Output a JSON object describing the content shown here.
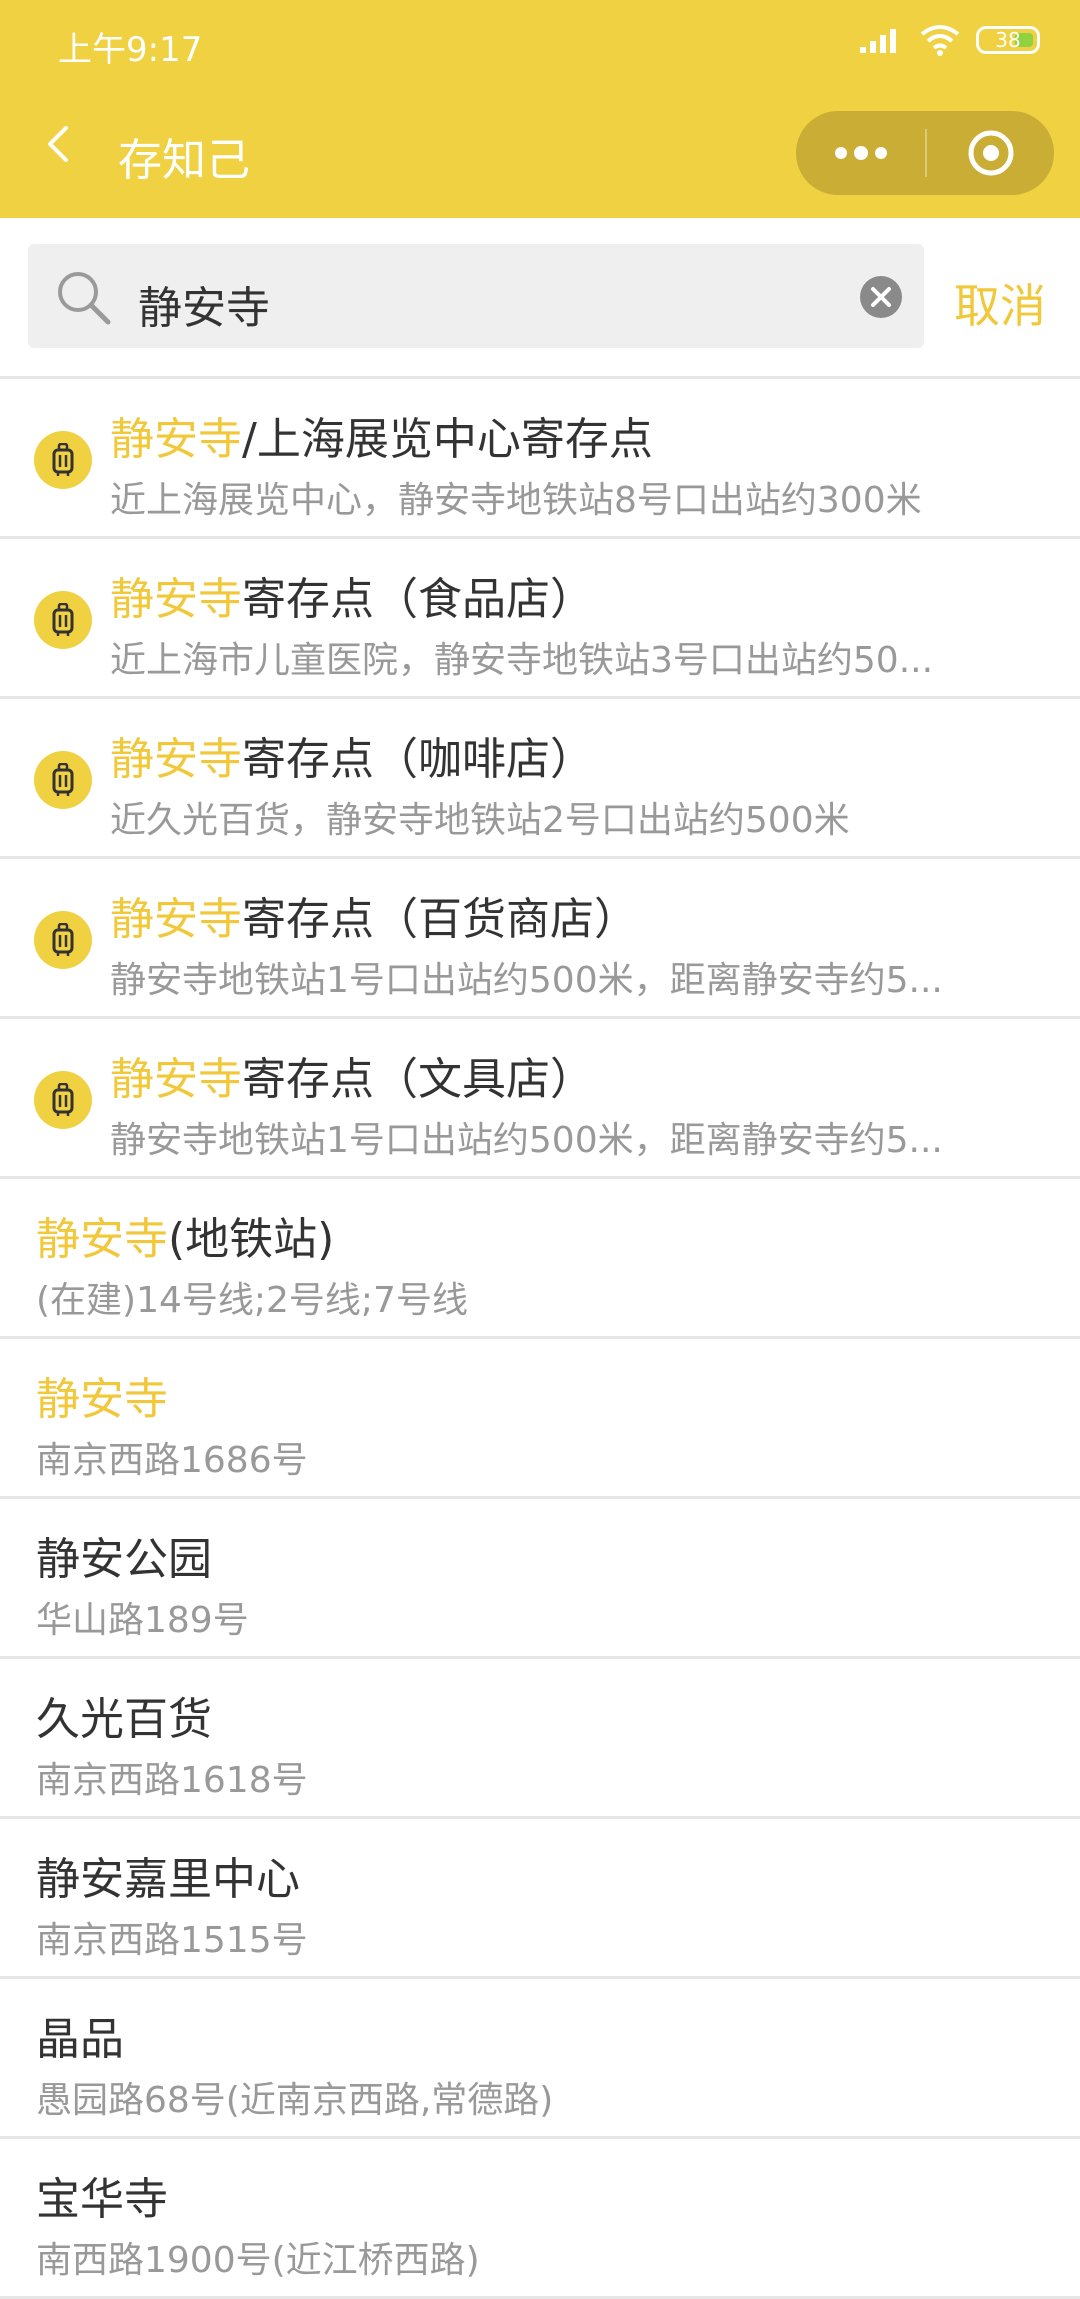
{
  "status_bar": {
    "time": "上午9:17",
    "battery": "38"
  },
  "nav": {
    "title": "存知己"
  },
  "search": {
    "query": "静安寺",
    "cancel_label": "取消"
  },
  "results": [
    {
      "type": "store",
      "highlight": "静安寺",
      "rest": "/上海展览中心寄存点",
      "sub": "近上海展览中心，静安寺地铁站8号口出站约300米"
    },
    {
      "type": "store",
      "highlight": "静安寺",
      "rest": "寄存点（食品店）",
      "sub": "近上海市儿童医院，静安寺地铁站3号口出站约50..."
    },
    {
      "type": "store",
      "highlight": "静安寺",
      "rest": "寄存点（咖啡店）",
      "sub": "近久光百货，静安寺地铁站2号口出站约500米"
    },
    {
      "type": "store",
      "highlight": "静安寺",
      "rest": "寄存点（百货商店）",
      "sub": "静安寺地铁站1号口出站约500米，距离静安寺约5..."
    },
    {
      "type": "store",
      "highlight": "静安寺",
      "rest": "寄存点（文具店）",
      "sub": "静安寺地铁站1号口出站约500米，距离静安寺约5..."
    },
    {
      "type": "place",
      "highlight": "静安寺",
      "rest": "(地铁站)",
      "sub": "(在建)14号线;2号线;7号线"
    },
    {
      "type": "place",
      "highlight": "静安寺",
      "rest": "",
      "sub": "南京西路1686号"
    },
    {
      "type": "place",
      "highlight": "",
      "rest": "静安公园",
      "sub": "华山路189号"
    },
    {
      "type": "place",
      "highlight": "",
      "rest": "久光百货",
      "sub": "南京西路1618号"
    },
    {
      "type": "place",
      "highlight": "",
      "rest": "静安嘉里中心",
      "sub": "南京西路1515号"
    },
    {
      "type": "place",
      "highlight": "",
      "rest": "晶品",
      "sub": "愚园路68号(近南京西路,常德路)"
    },
    {
      "type": "place",
      "highlight": "",
      "rest": "宝华寺",
      "sub": "南西路1900号(近江桥西路)"
    }
  ],
  "colors": {
    "header": "#f0d141",
    "accent": "#f0c83a",
    "capsule": "#c9ad34"
  }
}
